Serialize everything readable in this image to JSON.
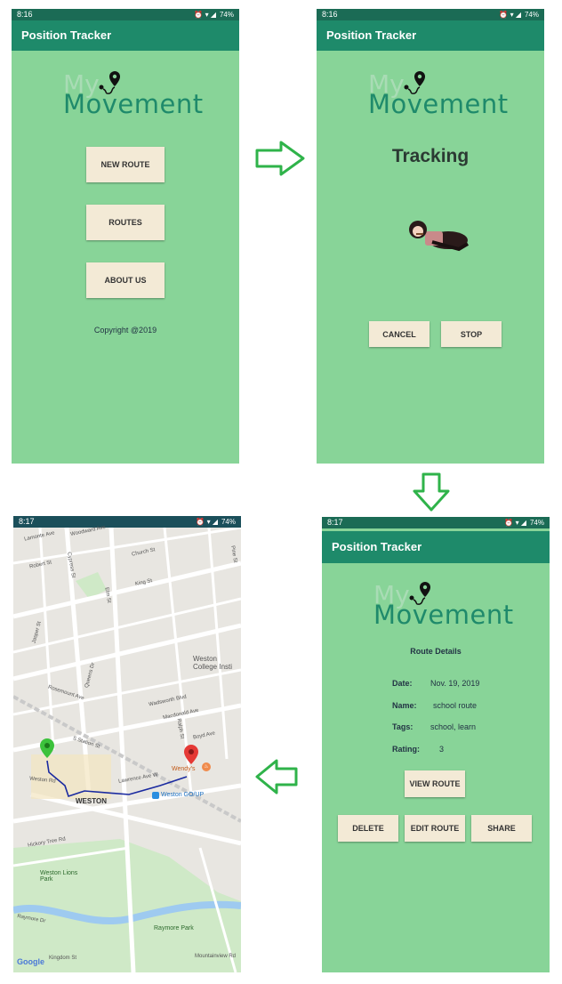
{
  "status": {
    "time_a": "8:16",
    "time_b": "8:17",
    "battery": "74%"
  },
  "app": {
    "title": "Position Tracker"
  },
  "logo": {
    "line1": "My",
    "line2": "Movement"
  },
  "home": {
    "new_route": "NEW ROUTE",
    "routes": "ROUTES",
    "about": "ABOUT US",
    "copyright": "Copyright @2019"
  },
  "tracking": {
    "heading": "Tracking",
    "cancel": "CANCEL",
    "stop": "STOP"
  },
  "details": {
    "heading": "Route Details",
    "date_label": "Date:",
    "date_value": "Nov. 19, 2019",
    "name_label": "Name:",
    "name_value": "school route",
    "tags_label": "Tags:",
    "tags_value": "school, learn",
    "rating_label": "Rating:",
    "rating_value": "3",
    "view_route": "VIEW ROUTE",
    "delete": "DELETE",
    "edit_route": "EDIT ROUTE",
    "share": "SHARE"
  },
  "map": {
    "streets": [
      "Lamonte Ave",
      "Woodward Ave",
      "Church St",
      "Pine St",
      "Robert St",
      "King St",
      "Cypress St",
      "Elm St",
      "Jasper St",
      "Queens Dr",
      "Rosemount Ave",
      "Weston College Insti",
      "Wadsworth Blvd",
      "Macdonald Ave",
      "Boyd Ave",
      "Ralph St",
      "S Station St",
      "Weston Rd",
      "Lawrence Ave W",
      "Hickory Tree Rd",
      "Raymore Dr",
      "Kingdom St",
      "Mountainview Rd"
    ],
    "places": {
      "weston": "WESTON",
      "wendys": "Wendy's",
      "station": "Weston GO/UP",
      "park1": "Weston Lions Park",
      "park2": "Raymore Park",
      "google": "Google"
    }
  },
  "colors": {
    "background": "#88d498",
    "appbar": "#1e8a6a",
    "button": "#f3ead6",
    "arrow": "#2fb34a"
  }
}
